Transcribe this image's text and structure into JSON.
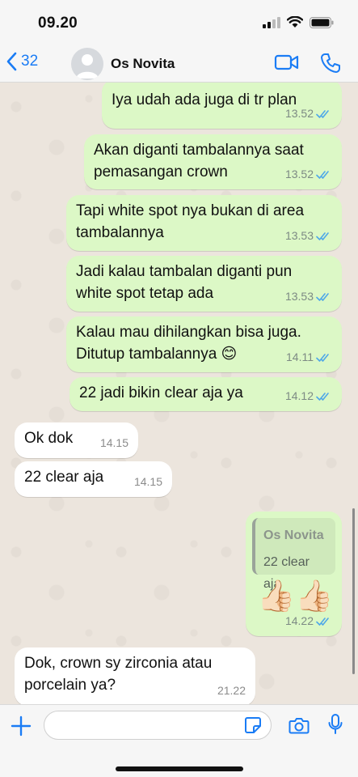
{
  "status": {
    "time": "09.20"
  },
  "header": {
    "back_count": "32",
    "contact_name": "Os Novita"
  },
  "messages": [
    {
      "text": "Iya udah ada juga di tr plan",
      "time": "13.52"
    },
    {
      "text": "Akan diganti tambalannya saat\npemasangan crown",
      "time": "13.52"
    },
    {
      "text": "Tapi white spot nya bukan di area\ntambalannya",
      "time": "13.53"
    },
    {
      "text": "Jadi kalau tambalan diganti pun\nwhite spot tetap ada",
      "time": "13.53"
    },
    {
      "text": "Kalau mau dihilangkan bisa juga.\nDitutup tambalannya 😊",
      "time": "14.11"
    },
    {
      "text": "22 jadi bikin clear aja ya",
      "time": "14.12"
    },
    {
      "text": "Ok dok",
      "time": "14.15"
    },
    {
      "text": "22 clear aja",
      "time": "14.15"
    },
    {
      "quote_name": "Os Novita",
      "quote_text": "22 clear aja",
      "emoji": "👍🏻👍🏻",
      "time": "14.22"
    },
    {
      "text": "Dok, crown sy zirconia atau\nporcelain ya?",
      "time": "21.22"
    }
  ],
  "input": {
    "value": "",
    "placeholder": ""
  },
  "colors": {
    "accent": "#1a7cf5",
    "outgoing_bubble": "#dcf8c6",
    "incoming_bubble": "#ffffff",
    "chat_background": "#ece5dd",
    "read_tick": "#4fa8e8"
  },
  "icons": {
    "back": "chevron-left-icon",
    "video": "video-camera-icon",
    "call": "phone-icon",
    "attach": "plus-icon",
    "sticker": "sticker-icon",
    "camera": "camera-icon",
    "mic": "microphone-icon"
  }
}
